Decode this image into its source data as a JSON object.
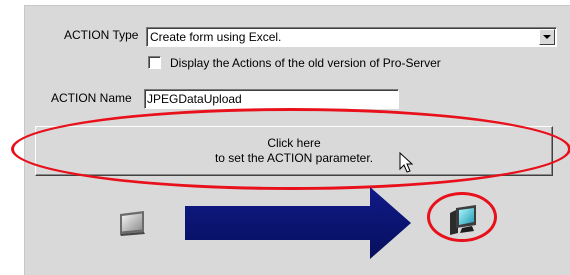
{
  "action_type": {
    "label": "ACTION Type",
    "value": "Create form using Excel."
  },
  "old_version_checkbox": {
    "label": "Display the Actions of the old version of Pro-Server",
    "checked": false
  },
  "action_name": {
    "label": "ACTION Name",
    "value": "JPEGDataUpload"
  },
  "parameter_button": {
    "line1": "Click here",
    "line2": "to set the ACTION parameter."
  },
  "icons": {
    "source": "display-monitor-icon",
    "flow": "right-arrow-icon",
    "target": "server-pc-icon",
    "cursor": "mouse-pointer-icon"
  },
  "colors": {
    "panel_bg": "#d9d9d9",
    "highlight": "#e8101a",
    "arrow": "#0a1478"
  }
}
